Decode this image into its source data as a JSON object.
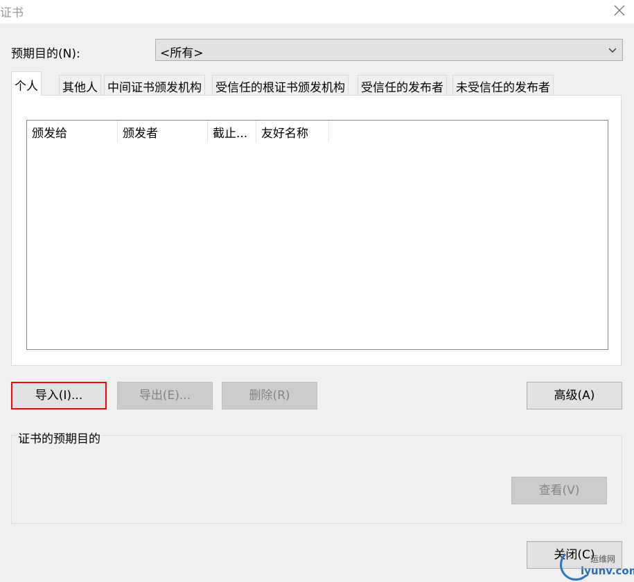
{
  "window": {
    "title": "证书"
  },
  "purpose": {
    "label": "预期目的(N):",
    "selected": "<所有>"
  },
  "tabs": [
    {
      "label": "个人",
      "active": true
    },
    {
      "label": "其他人",
      "active": false
    },
    {
      "label": "中间证书颁发机构",
      "active": false
    },
    {
      "label": "受信任的根证书颁发机构",
      "active": false
    },
    {
      "label": "受信任的发布者",
      "active": false
    },
    {
      "label": "未受信任的发布者",
      "active": false
    }
  ],
  "list": {
    "columns": [
      "颁发给",
      "颁发者",
      "截止...",
      "友好名称"
    ],
    "rows": []
  },
  "buttons": {
    "import": "导入(I)...",
    "export": "导出(E)...",
    "delete": "删除(R)",
    "advanced": "高级(A)",
    "view": "查看(V)",
    "close": "关闭(C)"
  },
  "group": {
    "title": "证书的预期目的"
  },
  "watermark": {
    "text": "运维网",
    "url": "iyunv.com"
  },
  "colors": {
    "highlight": "#ff0000",
    "button": "#e1e1e1",
    "disabled_text": "#838383"
  }
}
